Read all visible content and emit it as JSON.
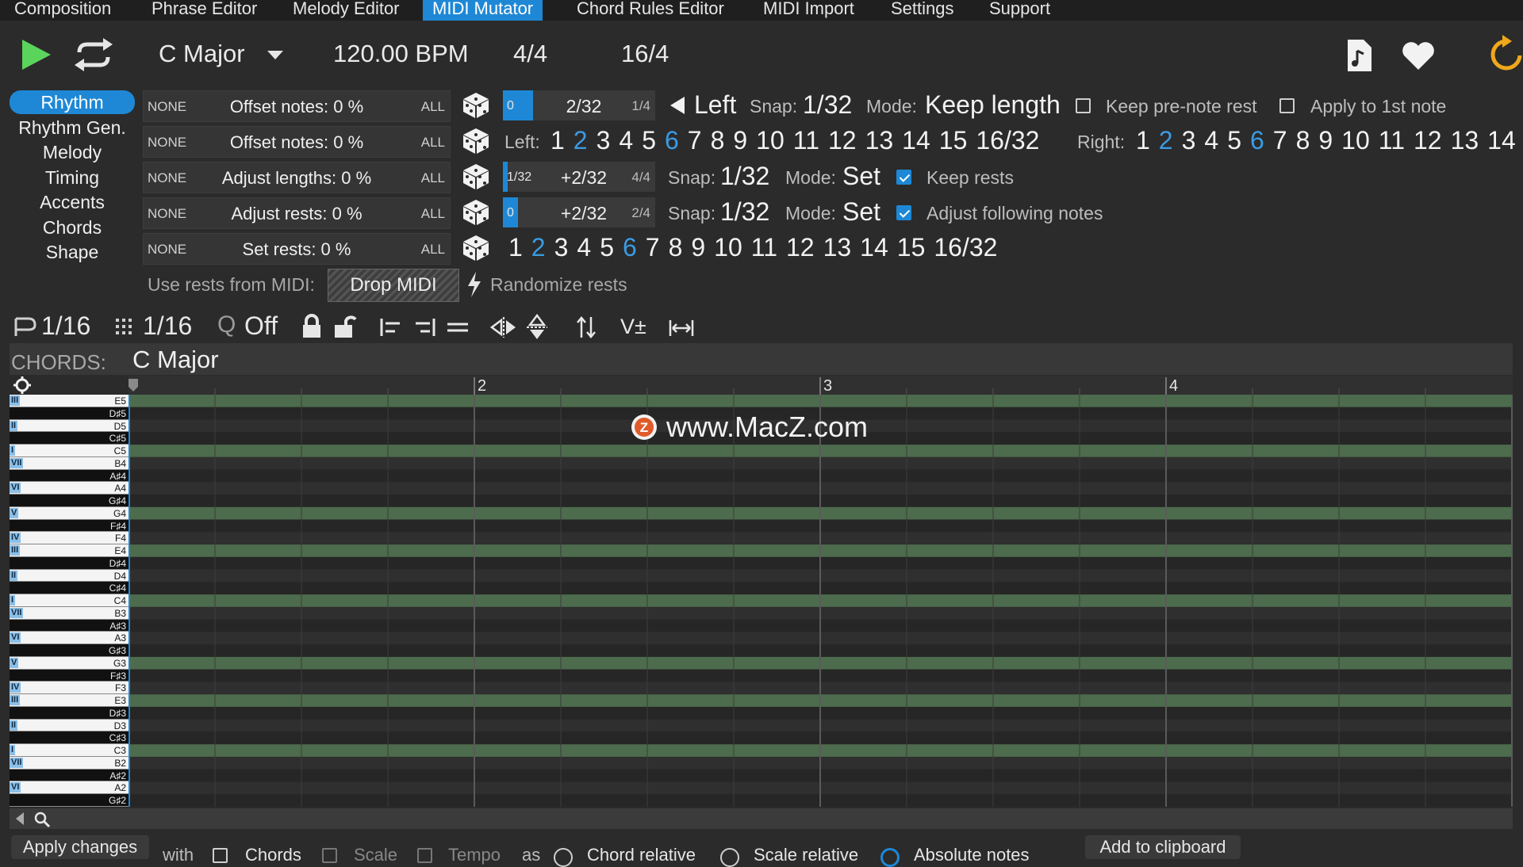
{
  "menu": [
    "Composition",
    "Phrase Editor",
    "Melody Editor",
    "MIDI Mutator",
    "Chord Rules Editor",
    "MIDI Import",
    "Settings",
    "Support"
  ],
  "menu_active": "MIDI Mutator",
  "transport": {
    "key": "C Major",
    "bpm": "120.00 BPM",
    "time_signature": "4/4",
    "length": "16/4"
  },
  "side_tabs": [
    "Rhythm",
    "Rhythm Gen.",
    "Melody",
    "Timing",
    "Accents",
    "Chords",
    "Shape"
  ],
  "side_active": "Rhythm",
  "rows": [
    {
      "none": "NONE",
      "label": "Offset notes: 0 %",
      "all": "ALL"
    },
    {
      "none": "NONE",
      "label": "Offset notes: 0 %",
      "all": "ALL"
    },
    {
      "none": "NONE",
      "label": "Adjust lengths: 0 %",
      "all": "ALL"
    },
    {
      "none": "NONE",
      "label": "Adjust rests: 0 %",
      "all": "ALL"
    },
    {
      "none": "NONE",
      "label": "Set rests: 0 %",
      "all": "ALL"
    }
  ],
  "ranges": [
    {
      "a": "0",
      "b": "2/32",
      "c": "1/4",
      "fill": 0.2
    },
    {
      "a": "1/32",
      "b": "+2/32",
      "c": "4/4",
      "fill": 0.03
    },
    {
      "a": "0",
      "b": "+2/32",
      "c": "2/4",
      "fill": 0.1
    }
  ],
  "row1_opts": {
    "direction": "Left",
    "snap_label": "Snap:",
    "snap_value": "1/32",
    "mode_label": "Mode:",
    "mode_value": "Keep length",
    "opt1": "Keep pre-note rest",
    "opt2": "Apply to 1st note"
  },
  "row2_opts": {
    "left_label": "Left:",
    "left_nums": [
      "1",
      "2",
      "3",
      "4",
      "5",
      "6",
      "7",
      "8",
      "9",
      "10",
      "11",
      "12",
      "13",
      "14",
      "15",
      "16/32"
    ],
    "right_label": "Right:",
    "right_nums": [
      "1",
      "2",
      "3",
      "4",
      "5",
      "6",
      "7",
      "8",
      "9",
      "10",
      "11",
      "12",
      "13",
      "14"
    ]
  },
  "row3_opts": {
    "snap_label": "Snap:",
    "snap_value": "1/32",
    "mode_label": "Mode:",
    "mode_value": "Set",
    "check": "Keep rests"
  },
  "row4_opts": {
    "snap_label": "Snap:",
    "snap_value": "1/32",
    "mode_label": "Mode:",
    "mode_value": "Set",
    "check": "Adjust following notes"
  },
  "row5_nums": [
    "1",
    "2",
    "3",
    "4",
    "5",
    "6",
    "7",
    "8",
    "9",
    "10",
    "11",
    "12",
    "13",
    "14",
    "15",
    "16/32"
  ],
  "rests_row": {
    "label": "Use rests from MIDI:",
    "drop": "Drop MIDI",
    "randomize": "Randomize rests"
  },
  "toolbar2": {
    "a": "1/16",
    "b": "1/16",
    "q": "Q",
    "q_value": "Off",
    "v": "V±"
  },
  "chords": {
    "label": "CHORDS:",
    "value": "C Major"
  },
  "ruler": [
    "2",
    "3",
    "4"
  ],
  "watermark": "www.MacZ.com",
  "keys": [
    {
      "n": "E5",
      "b": false,
      "d": "III"
    },
    {
      "n": "D♯5",
      "b": true
    },
    {
      "n": "D5",
      "b": false,
      "d": "II"
    },
    {
      "n": "C♯5",
      "b": true
    },
    {
      "n": "C5",
      "b": false,
      "d": "I"
    },
    {
      "n": "B4",
      "b": false,
      "d": "VII"
    },
    {
      "n": "A♯4",
      "b": true
    },
    {
      "n": "A4",
      "b": false,
      "d": "VI"
    },
    {
      "n": "G♯4",
      "b": true
    },
    {
      "n": "G4",
      "b": false,
      "d": "V"
    },
    {
      "n": "F♯4",
      "b": true
    },
    {
      "n": "F4",
      "b": false,
      "d": "IV"
    },
    {
      "n": "E4",
      "b": false,
      "d": "III"
    },
    {
      "n": "D♯4",
      "b": true
    },
    {
      "n": "D4",
      "b": false,
      "d": "II"
    },
    {
      "n": "C♯4",
      "b": true
    },
    {
      "n": "C4",
      "b": false,
      "d": "I"
    },
    {
      "n": "B3",
      "b": false,
      "d": "VII"
    },
    {
      "n": "A♯3",
      "b": true
    },
    {
      "n": "A3",
      "b": false,
      "d": "VI"
    },
    {
      "n": "G♯3",
      "b": true
    },
    {
      "n": "G3",
      "b": false,
      "d": "V"
    },
    {
      "n": "F♯3",
      "b": true
    },
    {
      "n": "F3",
      "b": false,
      "d": "IV"
    },
    {
      "n": "E3",
      "b": false,
      "d": "III"
    },
    {
      "n": "D♯3",
      "b": true
    },
    {
      "n": "D3",
      "b": false,
      "d": "II"
    },
    {
      "n": "C♯3",
      "b": true
    },
    {
      "n": "C3",
      "b": false,
      "d": "I"
    },
    {
      "n": "B2",
      "b": false,
      "d": "VII"
    },
    {
      "n": "A♯2",
      "b": true
    },
    {
      "n": "A2",
      "b": false,
      "d": "VI"
    },
    {
      "n": "G♯2",
      "b": true
    }
  ],
  "footer": {
    "apply": "Apply changes",
    "with": "with",
    "chords": "Chords",
    "scale": "Scale",
    "tempo": "Tempo",
    "as": "as",
    "r1": "Chord relative",
    "r2": "Scale relative",
    "r3": "Absolute notes",
    "clip": "Add to clipboard"
  },
  "colors": {
    "accent": "#1e88d6",
    "chord_row": "#4d6b4d",
    "bg": "#2b2b2b"
  }
}
